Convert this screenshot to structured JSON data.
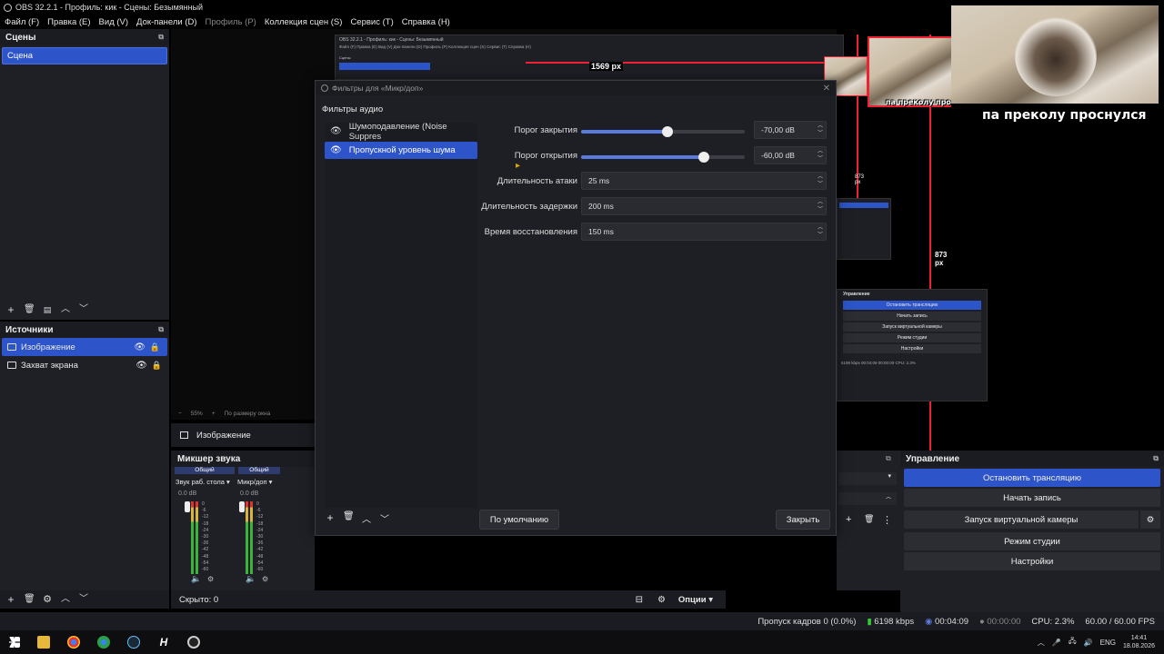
{
  "window": {
    "title": "OBS 32.2.1 - Профиль: кик - Сцены: Безымянный"
  },
  "menu": [
    {
      "label": "Файл (F)",
      "enabled": true
    },
    {
      "label": "Правка (E)",
      "enabled": true
    },
    {
      "label": "Вид (V)",
      "enabled": true
    },
    {
      "label": "Док-панели (D)",
      "enabled": true
    },
    {
      "label": "Профиль (P)",
      "enabled": false
    },
    {
      "label": "Коллекция сцен (S)",
      "enabled": true
    },
    {
      "label": "Сервис (T)",
      "enabled": true
    },
    {
      "label": "Справка (H)",
      "enabled": true
    }
  ],
  "scenes": {
    "title": "Сцены",
    "items": [
      "Сцена"
    ]
  },
  "sources": {
    "title": "Источники",
    "items": [
      {
        "label": "Изображение",
        "icon": "image-icon"
      },
      {
        "label": "Захват экрана",
        "icon": "monitor-icon"
      }
    ]
  },
  "preview": {
    "zoom": "55%",
    "fit_label": "По размеру окна",
    "dim_label_1": "1569 px",
    "dim_label_2": "873 px",
    "dim_label_3": "873 px",
    "overlay_caption": "па преколу проснулся",
    "mini_title": "OBS 32.2.1 - Профиль: кик - Сцены: Безымянный",
    "mini_menu": "Файл (F)   Правка (E)   Вид (V)   Док-панели (D)   Профиль (P)   Коллекция сцен (S)   Сервис (T)   Справка (H)",
    "mini_scenes": "Сцены",
    "mini_controls_title": "Управление",
    "mini_controls": [
      "Остановить трансляцию",
      "Начать запись",
      "Запуск виртуальной камеры",
      "Режим студии",
      "Настройки"
    ],
    "mini_status": "6198 kbps  00:04:09  00:00:00  CPU: 2.3%"
  },
  "source_toolbar": {
    "label": "Изображение"
  },
  "mixer": {
    "title": "Микшер звука",
    "channels": [
      {
        "tag": "Общий",
        "name": "Звук раб. стола",
        "db": "0.0 dB"
      },
      {
        "tag": "Общий",
        "name": "Микр/доп",
        "db": "0.0 dB"
      }
    ],
    "scale": [
      "0",
      "-6",
      "-12",
      "-18",
      "-24",
      "-30",
      "-36",
      "-42",
      "-48",
      "-54",
      "-60"
    ]
  },
  "controls": {
    "title": "Управление",
    "buttons": [
      "Остановить трансляцию",
      "Начать запись",
      "Запуск виртуальной камеры",
      "Режим студии",
      "Настройки"
    ]
  },
  "transitions": {
    "hidden_label": "Скрыто: 0",
    "options_label": "Опции"
  },
  "dialog": {
    "title": "Фильтры для «Микр/доп»",
    "section": "Фильтры аудио",
    "filters": [
      {
        "label": "Шумоподавление (Noise Suppres",
        "selected": false
      },
      {
        "label": "Пропускной уровень шума",
        "selected": true
      }
    ],
    "props": [
      {
        "label": "Порог закрытия",
        "value": "-70,00 dB",
        "slider": 0.53
      },
      {
        "label": "Порог открытия",
        "value": "-60,00 dB",
        "slider": 0.75
      },
      {
        "label": "Длительность атаки",
        "value": "25 ms"
      },
      {
        "label": "Длительность задержки",
        "value": "200 ms"
      },
      {
        "label": "Время восстановления",
        "value": "150 ms"
      }
    ],
    "defaults_button": "По умолчанию",
    "close_button": "Закрыть"
  },
  "status": {
    "dropped": "Пропуск кадров 0 (0.0%)",
    "bitrate": "6198 kbps",
    "stream_time": "00:04:09",
    "rec_time": "00:00:00",
    "cpu": "CPU: 2.3%",
    "fps": "60.00 / 60.00 FPS"
  },
  "webcam": {
    "caption": "па преколу проснулся"
  },
  "taskbar": {
    "lang": "ENG",
    "time": "14:41",
    "date": "18.08.2026"
  },
  "colors": {
    "accent": "#2d55c9",
    "bg": "#1f2026",
    "red": "#e23"
  }
}
